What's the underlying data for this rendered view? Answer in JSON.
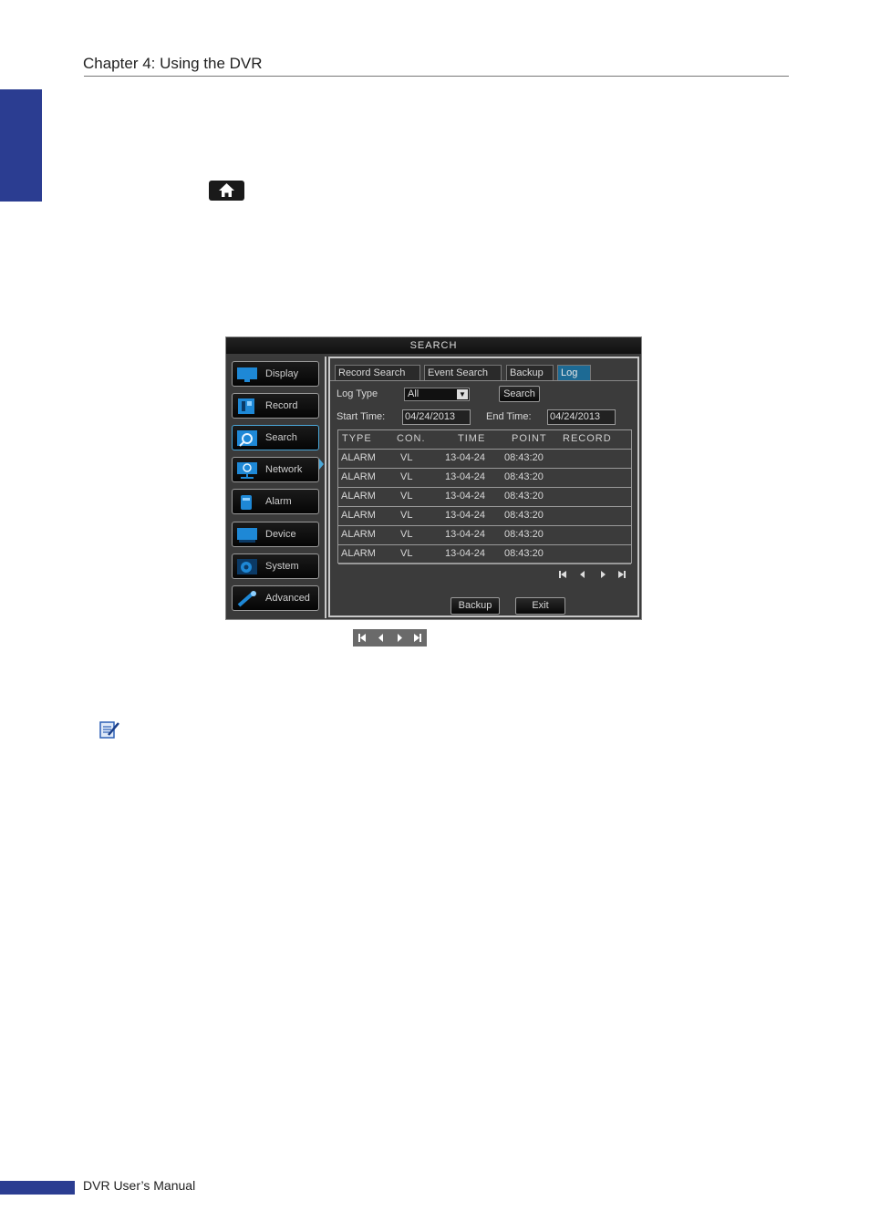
{
  "page": {
    "chapter_title": "Chapter 4: Using the DVR",
    "footer_text": "DVR User’s Manual",
    "accent_color": "#2b3d91"
  },
  "dvr": {
    "window_title": "SEARCH",
    "sidebar": [
      {
        "label": "Display",
        "icon": "monitor-icon"
      },
      {
        "label": "Record",
        "icon": "record-icon"
      },
      {
        "label": "Search",
        "icon": "magnifier-icon",
        "active": true
      },
      {
        "label": "Network",
        "icon": "globe-network-icon"
      },
      {
        "label": "Alarm",
        "icon": "alarm-icon"
      },
      {
        "label": "Device",
        "icon": "device-icon"
      },
      {
        "label": "System",
        "icon": "gear-icon"
      },
      {
        "label": "Advanced",
        "icon": "wrench-icon"
      }
    ],
    "tabs": [
      {
        "label": "Record Search"
      },
      {
        "label": "Event Search"
      },
      {
        "label": "Backup"
      },
      {
        "label": "Log",
        "active": true
      }
    ],
    "log_type_label": "Log Type",
    "log_type_value": "All",
    "search_button": "Search",
    "start_time_label": "Start Time:",
    "start_time_value": "04/24/2013",
    "end_time_label": "End Time:",
    "end_time_value": "04/24/2013",
    "table": {
      "columns": [
        "TYPE",
        "CON.",
        "TIME",
        "POINT",
        "RECORD"
      ],
      "rows": [
        {
          "type": "ALARM",
          "con": "VL",
          "date": "13-04-24",
          "time": "08:43:20"
        },
        {
          "type": "ALARM",
          "con": "VL",
          "date": "13-04-24",
          "time": "08:43:20"
        },
        {
          "type": "ALARM",
          "con": "VL",
          "date": "13-04-24",
          "time": "08:43:20"
        },
        {
          "type": "ALARM",
          "con": "VL",
          "date": "13-04-24",
          "time": "08:43:20"
        },
        {
          "type": "ALARM",
          "con": "VL",
          "date": "13-04-24",
          "time": "08:43:20"
        },
        {
          "type": "ALARM",
          "con": "VL",
          "date": "13-04-24",
          "time": "08:43:20"
        }
      ]
    },
    "backup_button": "Backup",
    "exit_button": "Exit"
  }
}
